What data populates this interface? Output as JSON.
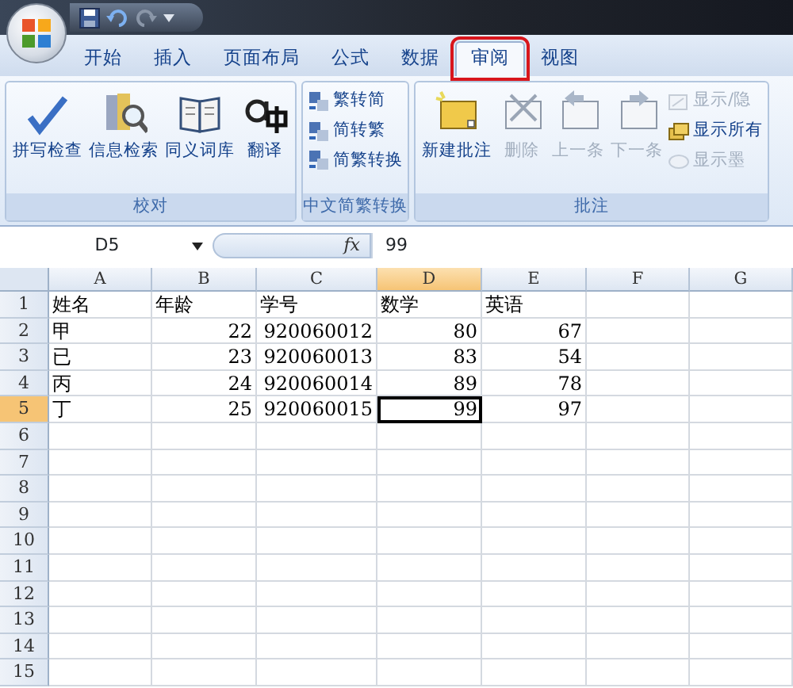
{
  "tabs": [
    {
      "label": "开始",
      "selected": false,
      "annotated": false
    },
    {
      "label": "插入",
      "selected": false,
      "annotated": false
    },
    {
      "label": "页面布局",
      "selected": false,
      "annotated": false
    },
    {
      "label": "公式",
      "selected": false,
      "annotated": false
    },
    {
      "label": "数据",
      "selected": false,
      "annotated": false
    },
    {
      "label": "审阅",
      "selected": true,
      "annotated": true
    },
    {
      "label": "视图",
      "selected": false,
      "annotated": false
    }
  ],
  "ribbon": {
    "groups": [
      {
        "label": "校对",
        "buttons": [
          {
            "label": "拼写检查",
            "kind": "large",
            "disabled": false
          },
          {
            "label": "信息检索",
            "kind": "large",
            "disabled": false
          },
          {
            "label": "同义词库",
            "kind": "large",
            "disabled": false
          },
          {
            "label": "翻译",
            "kind": "large",
            "disabled": false
          }
        ]
      },
      {
        "label": "中文简繁转换",
        "buttons": [
          {
            "label": "繁转简",
            "kind": "small",
            "disabled": false
          },
          {
            "label": "简转繁",
            "kind": "small",
            "disabled": false
          },
          {
            "label": "简繁转换",
            "kind": "small",
            "disabled": false
          }
        ]
      },
      {
        "label": "批注",
        "buttons": [
          {
            "label": "新建批注",
            "kind": "large",
            "disabled": false
          },
          {
            "label": "删除",
            "kind": "large",
            "disabled": true
          },
          {
            "label": "上一条",
            "kind": "large",
            "disabled": true
          },
          {
            "label": "下一条",
            "kind": "large",
            "disabled": true
          },
          {
            "label": "显示/隐",
            "kind": "small",
            "disabled": true
          },
          {
            "label": "显示所有",
            "kind": "small",
            "disabled": false
          },
          {
            "label": "显示墨",
            "kind": "small",
            "disabled": true
          }
        ]
      }
    ]
  },
  "formula_bar": {
    "name_box": "D5",
    "fx": "fx",
    "value": "99"
  },
  "sheet": {
    "columns": [
      {
        "label": "A",
        "selected": false
      },
      {
        "label": "B",
        "selected": false
      },
      {
        "label": "C",
        "selected": false
      },
      {
        "label": "D",
        "selected": true
      },
      {
        "label": "E",
        "selected": false
      },
      {
        "label": "F",
        "selected": false
      },
      {
        "label": "G",
        "selected": false
      }
    ],
    "rows": [
      {
        "label": "1",
        "selected": false,
        "cells": [
          {
            "text": "姓名",
            "kind": "text",
            "active": false
          },
          {
            "text": "年龄",
            "kind": "text",
            "active": false
          },
          {
            "text": "学号",
            "kind": "text",
            "active": false
          },
          {
            "text": "数学",
            "kind": "text",
            "active": false
          },
          {
            "text": "英语",
            "kind": "text",
            "active": false
          }
        ]
      },
      {
        "label": "2",
        "selected": false,
        "cells": [
          {
            "text": "甲",
            "kind": "text",
            "active": false
          },
          {
            "text": "22",
            "kind": "number",
            "active": false
          },
          {
            "text": "920060012",
            "kind": "number",
            "active": false
          },
          {
            "text": "80",
            "kind": "number",
            "active": false
          },
          {
            "text": "67",
            "kind": "number",
            "active": false
          }
        ]
      },
      {
        "label": "3",
        "selected": false,
        "cells": [
          {
            "text": "已",
            "kind": "text",
            "active": false
          },
          {
            "text": "23",
            "kind": "number",
            "active": false
          },
          {
            "text": "920060013",
            "kind": "number",
            "active": false
          },
          {
            "text": "83",
            "kind": "number",
            "active": false
          },
          {
            "text": "54",
            "kind": "number",
            "active": false
          }
        ]
      },
      {
        "label": "4",
        "selected": false,
        "cells": [
          {
            "text": "丙",
            "kind": "text",
            "active": false
          },
          {
            "text": "24",
            "kind": "number",
            "active": false
          },
          {
            "text": "920060014",
            "kind": "number",
            "active": false
          },
          {
            "text": "89",
            "kind": "number",
            "active": false
          },
          {
            "text": "78",
            "kind": "number",
            "active": false
          }
        ]
      },
      {
        "label": "5",
        "selected": true,
        "cells": [
          {
            "text": "丁",
            "kind": "text",
            "active": false
          },
          {
            "text": "25",
            "kind": "number",
            "active": false
          },
          {
            "text": "920060015",
            "kind": "number",
            "active": false
          },
          {
            "text": "99",
            "kind": "number",
            "active": true
          },
          {
            "text": "97",
            "kind": "number",
            "active": false
          }
        ]
      },
      {
        "label": "6",
        "selected": false
      },
      {
        "label": "7",
        "selected": false
      },
      {
        "label": "8",
        "selected": false
      },
      {
        "label": "9",
        "selected": false
      },
      {
        "label": "10",
        "selected": false
      },
      {
        "label": "11",
        "selected": false
      },
      {
        "label": "12",
        "selected": false
      },
      {
        "label": "13",
        "selected": false
      },
      {
        "label": "14",
        "selected": false
      },
      {
        "label": "15",
        "selected": false
      }
    ]
  }
}
